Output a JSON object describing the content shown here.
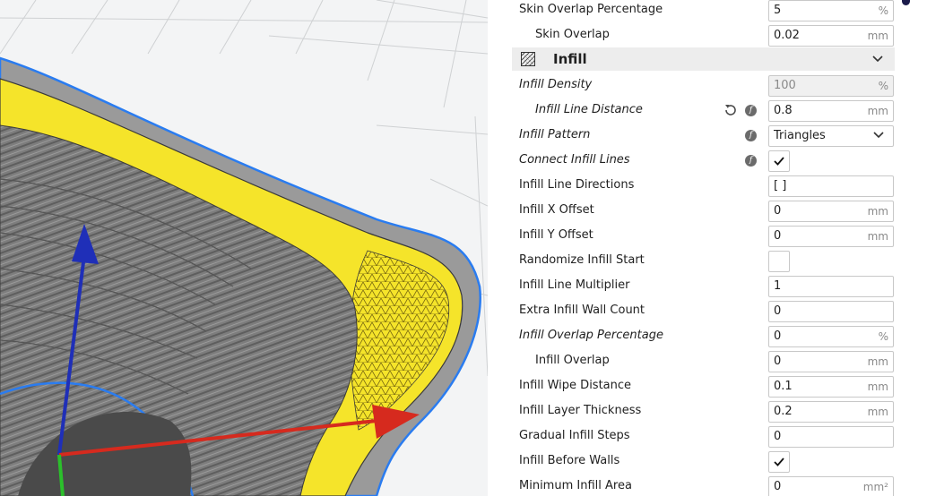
{
  "viewport": {
    "colors": {
      "background": "#f3f4f5",
      "grid": "#cfd1d3",
      "infill": "#f5e42a",
      "wall": "#8a8a8a",
      "outline": "#2a7cf0",
      "axis_x": "#d62a1e",
      "axis_y": "#1f2fb8",
      "axis_z": "#2bbf2b"
    }
  },
  "settings": {
    "rows": [
      {
        "label": "Skin Overlap Percentage",
        "value": "5",
        "unit": "%"
      },
      {
        "label": "Skin Overlap",
        "value": "0.02",
        "unit": "mm"
      },
      {
        "label": "Infill Density",
        "value": "100",
        "unit": "%"
      },
      {
        "label": "Infill Line Distance",
        "value": "0.8",
        "unit": "mm"
      },
      {
        "label": "Infill Pattern",
        "value": "Triangles"
      },
      {
        "label": "Connect Infill Lines"
      },
      {
        "label": "Infill Line Directions",
        "value": "[ ]"
      },
      {
        "label": "Infill X Offset",
        "value": "0",
        "unit": "mm"
      },
      {
        "label": "Infill Y Offset",
        "value": "0",
        "unit": "mm"
      },
      {
        "label": "Randomize Infill Start"
      },
      {
        "label": "Infill Line Multiplier",
        "value": "1"
      },
      {
        "label": "Extra Infill Wall Count",
        "value": "0"
      },
      {
        "label": "Infill Overlap Percentage",
        "value": "0",
        "unit": "%"
      },
      {
        "label": "Infill Overlap",
        "value": "0",
        "unit": "mm"
      },
      {
        "label": "Infill Wipe Distance",
        "value": "0.1",
        "unit": "mm"
      },
      {
        "label": "Infill Layer Thickness",
        "value": "0.2",
        "unit": "mm"
      },
      {
        "label": "Gradual Infill Steps",
        "value": "0"
      },
      {
        "label": "Infill Before Walls"
      },
      {
        "label": "Minimum Infill Area",
        "value": "0",
        "unit": "mm²"
      }
    ],
    "category": {
      "label": "Infill",
      "icon": "infill-category-icon"
    },
    "checkboxes": {
      "connect_infill_lines": true,
      "randomize_infill_start": false,
      "infill_before_walls": true
    },
    "icons": {
      "reset": "reset-icon",
      "fx": "fx-icon",
      "chevron": "chevron-down-icon",
      "check": "checkmark-icon"
    }
  }
}
